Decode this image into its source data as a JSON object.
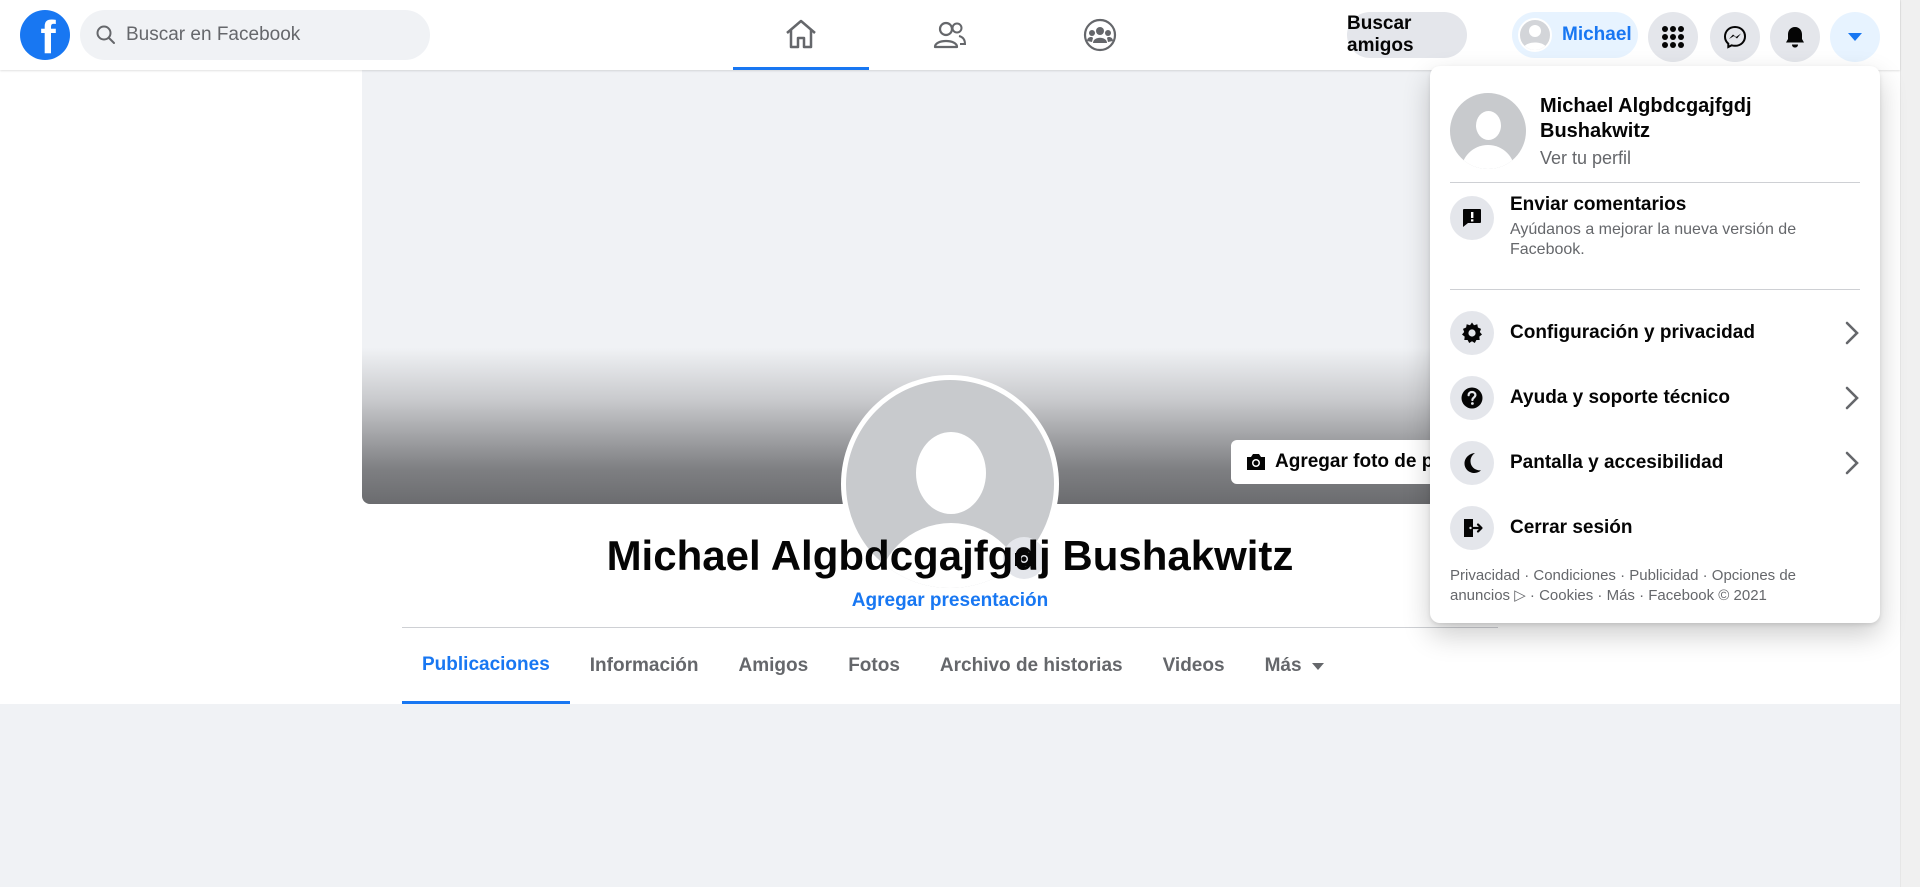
{
  "header": {
    "logo_letter": "f",
    "search_placeholder": "Buscar en Facebook",
    "find_friends_label": "Buscar amigos",
    "profile_short_name": "Michael"
  },
  "profile": {
    "name": "Michael Algbdcgajfgdj Bushakwitz",
    "add_bio": "Agregar presentación",
    "add_cover": "Agregar foto de portada",
    "tabs": [
      {
        "label": "Publicaciones"
      },
      {
        "label": "Información"
      },
      {
        "label": "Amigos"
      },
      {
        "label": "Fotos"
      },
      {
        "label": "Archivo de historias"
      },
      {
        "label": "Videos"
      },
      {
        "label": "Más"
      }
    ]
  },
  "menu": {
    "name": "Michael Algbdcgajfgdj Bushakwitz",
    "view_profile": "Ver tu perfil",
    "feedback_title": "Enviar comentarios",
    "feedback_desc": "Ayúdanos a mejorar la nueva versión de Facebook.",
    "items": [
      {
        "label": "Configuración y privacidad",
        "icon": "gear-icon"
      },
      {
        "label": "Ayuda y soporte técnico",
        "icon": "question-icon"
      },
      {
        "label": "Pantalla y accesibilidad",
        "icon": "moon-icon"
      },
      {
        "label": "Cerrar sesión",
        "icon": "logout-icon"
      }
    ],
    "footer": "Privacidad · Condiciones · Publicidad · Opciones de anuncios ▷ · Cookies · Más · Facebook © 2021"
  },
  "colors": {
    "brand": "#1877f2",
    "background": "#f0f2f5",
    "secondary_text": "#65676b"
  }
}
